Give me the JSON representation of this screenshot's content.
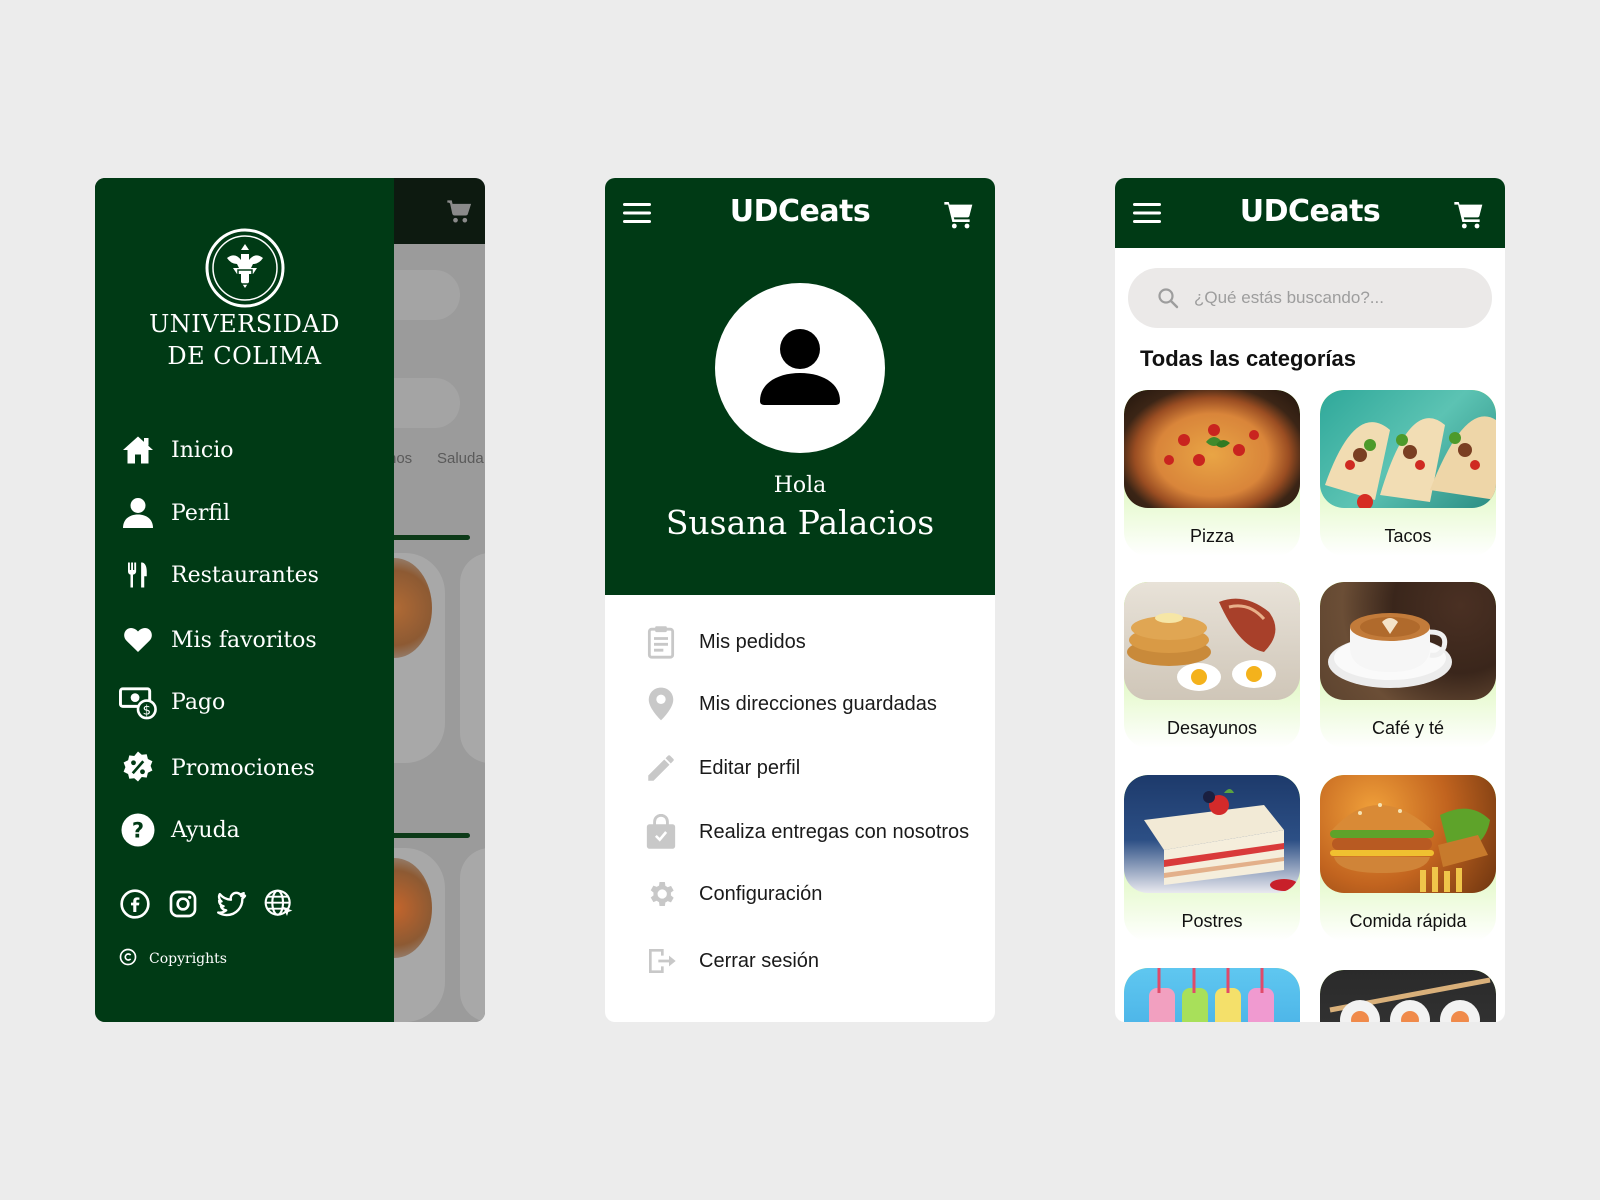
{
  "drawer_screen": {
    "university_line1": "UNIVERSIDAD",
    "university_line2": "DE COLIMA",
    "menu": [
      {
        "label": "Inicio",
        "icon": "home-icon"
      },
      {
        "label": "Perfil",
        "icon": "user-icon"
      },
      {
        "label": "Restaurantes",
        "icon": "utensils-icon"
      },
      {
        "label": "Mis favoritos",
        "icon": "heart-icon"
      },
      {
        "label": "Pago",
        "icon": "money-icon"
      },
      {
        "label": "Promociones",
        "icon": "discount-icon"
      },
      {
        "label": "Ayuda",
        "icon": "help-icon"
      }
    ],
    "social_icons": [
      "facebook-icon",
      "instagram-icon",
      "twitter-icon",
      "web-icon"
    ],
    "copyright": "Copyrights",
    "background_chips": [
      "nos",
      "Saluda"
    ]
  },
  "profile_screen": {
    "app_title": "UDCeats",
    "greeting": "Hola",
    "user_name": "Susana Palacios",
    "options": [
      {
        "label": "Mis pedidos",
        "icon": "clipboard-icon"
      },
      {
        "label": "Mis direcciones guardadas",
        "icon": "location-pin-icon"
      },
      {
        "label": "Editar perfil",
        "icon": "pencil-icon"
      },
      {
        "label": "Realiza entregas con nosotros",
        "icon": "shopping-bag-icon"
      },
      {
        "label": "Configuración",
        "icon": "gear-icon"
      },
      {
        "label": "Cerrar sesión",
        "icon": "logout-icon"
      }
    ]
  },
  "categories_screen": {
    "app_title": "UDCeats",
    "search_placeholder": "¿Qué estás buscando?...",
    "section_title": "Todas las categorías",
    "categories": [
      {
        "label": "Pizza"
      },
      {
        "label": "Tacos"
      },
      {
        "label": "Desayunos"
      },
      {
        "label": "Café y té"
      },
      {
        "label": "Postres"
      },
      {
        "label": "Comida rápida"
      }
    ]
  },
  "colors": {
    "brand_green": "#003a15",
    "accent_lime": "#b6f36a",
    "background": "#ececec"
  }
}
